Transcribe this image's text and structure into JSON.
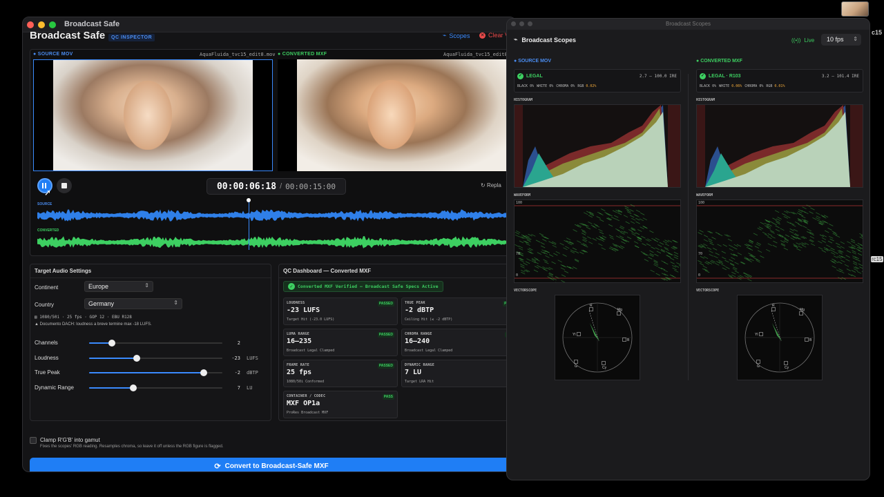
{
  "main_window": {
    "title": "Broadcast Safe",
    "app_title": "Broadcast Safe",
    "badge": "QC INSPECTOR",
    "scopes_label": "Scopes",
    "clear_label": "Clear V",
    "source": {
      "label": "SOURCE MOV",
      "filename": "AquaFluida_tvc15_edit8.mov"
    },
    "converted": {
      "label": "CONVERTED MXF",
      "filename": "AquaFluida_tvc15_edit8"
    },
    "timecode": {
      "current": "00:00:06:18",
      "separator": "/",
      "total": "00:00:15:00"
    },
    "replay_label": "Repla",
    "playhead_fraction": 0.45,
    "wave_labels": {
      "source": "SOURCE",
      "converted": "CONVERTED"
    }
  },
  "audio_settings": {
    "title": "Target Audio Settings",
    "continent_label": "Continent",
    "continent_value": "Europe",
    "country_label": "Country",
    "country_value": "Germany",
    "spec_line": "1080/50i · 25 fps · GOP 12 · EBU R128",
    "note_line": "Documento DACH: loudness a breve termine max -18 LUFS.",
    "sliders": [
      {
        "label": "Channels",
        "value": "2",
        "unit": "",
        "fraction": 0.17
      },
      {
        "label": "Loudness",
        "value": "-23",
        "unit": "LUFS",
        "fraction": 0.36
      },
      {
        "label": "True Peak",
        "value": "-2",
        "unit": "dBTP",
        "fraction": 0.86
      },
      {
        "label": "Dynamic Range",
        "value": "7",
        "unit": "LU",
        "fraction": 0.33
      }
    ]
  },
  "qc": {
    "title": "QC Dashboard — Converted MXF",
    "banner": "Converted MXF Verified — Broadcast Safe Specs Active",
    "cards": [
      {
        "title": "LOUDNESS",
        "badge": "PASSED",
        "value": "-23 LUFS",
        "sub": "Target Hit (-23.0 LUFS)"
      },
      {
        "title": "TRUE PEAK",
        "badge": "PAS",
        "value": "-2 dBTP",
        "sub": "Ceiling Hit (≤ -2 dBTP)"
      },
      {
        "title": "LUMA RANGE",
        "badge": "PASSED",
        "value": "16–235",
        "sub": "Broadcast Legal Clamped"
      },
      {
        "title": "CHROMA RANGE",
        "badge": "PA",
        "value": "16–240",
        "sub": "Broadcast Legal Clamped"
      },
      {
        "title": "FRAME RATE",
        "badge": "PASSED",
        "value": "25 fps",
        "sub": "1080/50i Conformed"
      },
      {
        "title": "DYNAMIC RANGE",
        "badge": "P",
        "value": "7 LU",
        "sub": "Target LRA Hit"
      },
      {
        "title": "CONTAINER / CODEC",
        "badge": "PASS",
        "value": "MXF OP1a",
        "sub": "ProRes Broadcast MXF"
      }
    ]
  },
  "clamp": {
    "label": "Clamp R'G'B' into gamut",
    "desc": "Fixes the scopes' RGB reading. Resamples chroma, so leave it off unless the RGB figure is flagged.",
    "checked": false
  },
  "convert_button": "Convert to Broadcast-Safe MXF",
  "scopes_window": {
    "title": "Broadcast Scopes",
    "header": "Broadcast Scopes",
    "live_label": "Live",
    "fps_value": "10 fps",
    "source": {
      "label": "SOURCE MOV",
      "status": "LEGAL",
      "range": "2.7 — 100.0 IRE",
      "stats": {
        "black_label": "BLACK",
        "black": "0%",
        "white_label": "WHITE",
        "white": "0%",
        "chroma_label": "CHROMA",
        "chroma": "0%",
        "rgb_label": "RGB",
        "rgb": "0.02%"
      }
    },
    "converted": {
      "label": "CONVERTED MXF",
      "status": "LEGAL · R103",
      "range": "3.2 — 101.4 IRE",
      "stats": {
        "black_label": "BLACK",
        "black": "0%",
        "white_label": "WHITE",
        "white": "0.06%",
        "chroma_label": "CHROMA",
        "chroma": "0%",
        "rgb_label": "RGB",
        "rgb": "0.01%"
      }
    },
    "histogram_label": "HISTOGRAM",
    "waveform_label": "WAVEFORM",
    "vectorscope_label": "VECTORSCOPE",
    "wf_top": "100",
    "wf_mid": "70",
    "wf_bottom": "0",
    "vector_targets": {
      "r": "R",
      "mg": "Mg",
      "yl": "Yl",
      "b": "B",
      "g": "G",
      "cy": "Cy"
    }
  },
  "bg_right": {
    "a": "c15",
    "b": "rc15"
  },
  "colors": {
    "accent": "#1f7ef5",
    "converted": "#3dcf61",
    "source_wave": "#2f7fe8",
    "warning": "#e84a4a"
  }
}
